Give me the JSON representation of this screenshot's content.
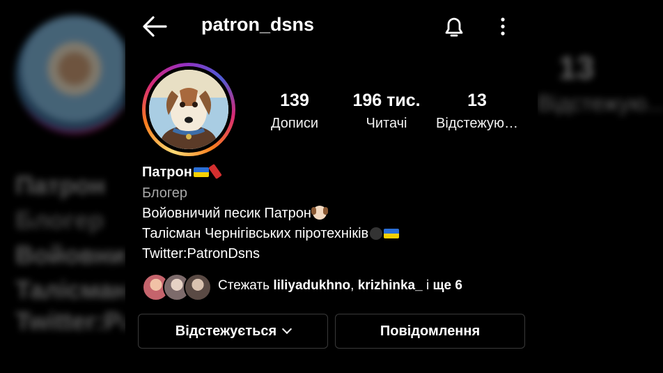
{
  "header": {
    "username": "patron_dsns"
  },
  "stats": [
    {
      "value": "139",
      "label": "Дописи"
    },
    {
      "value": "196 тис.",
      "label": "Читачі"
    },
    {
      "value": "13",
      "label": "Відстежую…"
    }
  ],
  "bio": {
    "name": "Патрон",
    "category": "Блогер",
    "line1": "Войовничий песик Патрон",
    "line2": "Талісман Чернігівських піротехніків",
    "line3": "Twitter:PatronDsns"
  },
  "followed_by": {
    "prefix": "Стежать ",
    "user1": "liliyadukhno",
    "separator": ", ",
    "user2": "krizhinka_",
    "middle": " і ",
    "rest": "ще 6"
  },
  "buttons": {
    "following_label": "Відстежується",
    "message_label": "Повідомлення"
  },
  "side_blur": {
    "left_lines": [
      "Патрон",
      "Блогер",
      "Войовнич",
      "Талісман",
      "Twitter:Pa"
    ],
    "right_number": "13",
    "right_label": "Відстежую..."
  },
  "icons": {
    "back": "arrow-left-icon",
    "bell": "bell-icon",
    "more": "more-vertical-icon",
    "chevron": "chevron-down-icon"
  }
}
